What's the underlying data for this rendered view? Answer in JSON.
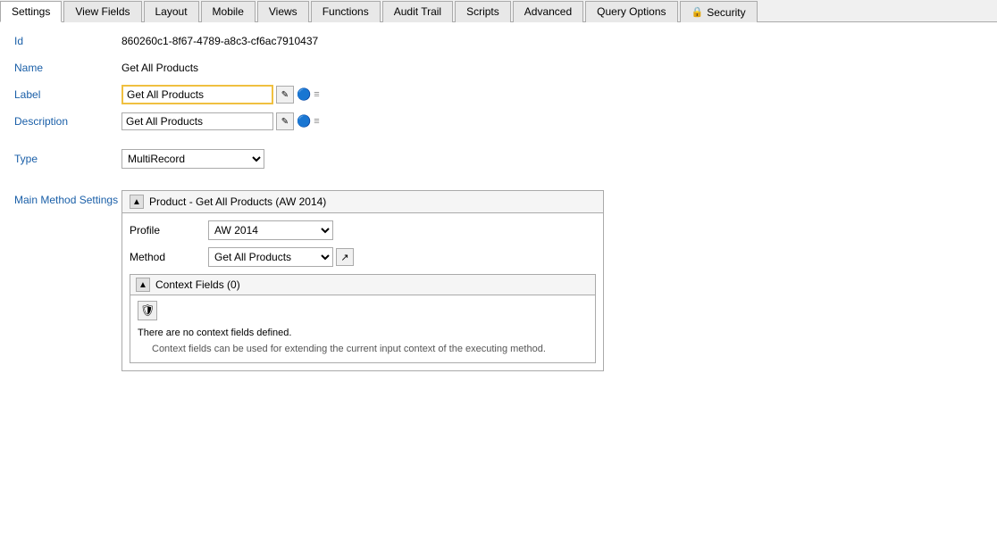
{
  "tabs": [
    {
      "id": "settings",
      "label": "Settings",
      "active": true
    },
    {
      "id": "view-fields",
      "label": "View Fields",
      "active": false
    },
    {
      "id": "layout",
      "label": "Layout",
      "active": false
    },
    {
      "id": "mobile",
      "label": "Mobile",
      "active": false
    },
    {
      "id": "views",
      "label": "Views",
      "active": false
    },
    {
      "id": "functions",
      "label": "Functions",
      "active": false
    },
    {
      "id": "audit-trail",
      "label": "Audit Trail",
      "active": false
    },
    {
      "id": "scripts",
      "label": "Scripts",
      "active": false
    },
    {
      "id": "advanced",
      "label": "Advanced",
      "active": false
    },
    {
      "id": "query-options",
      "label": "Query Options",
      "active": false
    },
    {
      "id": "security",
      "label": "Security",
      "active": false,
      "has_icon": true
    }
  ],
  "fields": {
    "id_label": "Id",
    "id_value": "860260c1-8f67-4789-a8c3-cf6ac7910437",
    "name_label": "Name",
    "name_value": "Get All Products",
    "label_label": "Label",
    "label_value": "Get All Products",
    "description_label": "Description",
    "description_value": "Get All Products",
    "type_label": "Type",
    "type_value": "MultiRecord"
  },
  "main_method": {
    "section_label": "Main Method Settings",
    "box_title": "Product  - Get All Products   (AW 2014)",
    "profile_label": "Profile",
    "profile_value": "AW 2014",
    "method_label": "Method",
    "method_value": "Get All Products",
    "context_fields_title": "Context Fields  (0)",
    "no_context_text": "There are no context fields defined.",
    "context_hint": "Context fields can be used for extending the current input context of the executing method."
  },
  "icons": {
    "collapse": "▲",
    "edit": "✎",
    "info": "🔵",
    "add": "🛡",
    "navigate": "↗",
    "lock": "🔒",
    "dropdown_arrow": "▼"
  }
}
